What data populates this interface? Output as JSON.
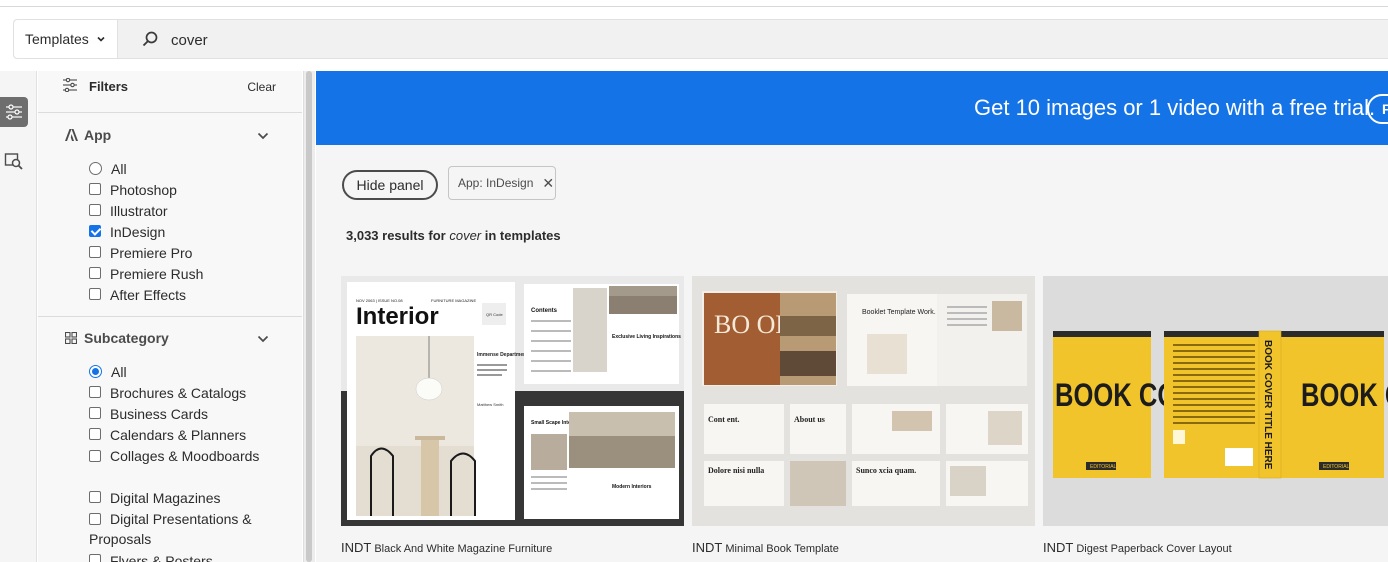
{
  "search": {
    "scope_label": "Templates",
    "query": "cover"
  },
  "filters": {
    "title": "Filters",
    "clear_label": "Clear"
  },
  "app_section": {
    "title": "App",
    "options": [
      {
        "label": "All",
        "type": "radio",
        "checked": false
      },
      {
        "label": "Photoshop",
        "type": "checkbox",
        "checked": false
      },
      {
        "label": "Illustrator",
        "type": "checkbox",
        "checked": false
      },
      {
        "label": "InDesign",
        "type": "checkbox",
        "checked": true
      },
      {
        "label": "Premiere Pro",
        "type": "checkbox",
        "checked": false
      },
      {
        "label": "Premiere Rush",
        "type": "checkbox",
        "checked": false
      },
      {
        "label": "After Effects",
        "type": "checkbox",
        "checked": false
      }
    ]
  },
  "subcategory_section": {
    "title": "Subcategory",
    "options": [
      {
        "label": "All",
        "type": "radio",
        "checked": true
      },
      {
        "label": "Brochures & Catalogs",
        "type": "checkbox",
        "checked": false
      },
      {
        "label": "Business Cards",
        "type": "checkbox",
        "checked": false
      },
      {
        "label": "Calendars & Planners",
        "type": "checkbox",
        "checked": false
      },
      {
        "label": "Collages & Moodboards",
        "type": "checkbox",
        "checked": false
      },
      {
        "label": "Digital Magazines",
        "type": "checkbox",
        "checked": false
      },
      {
        "label": "Digital Presentations & Proposals",
        "type": "checkbox",
        "checked": false
      },
      {
        "label": "Flyers & Posters",
        "type": "checkbox",
        "checked": false
      }
    ]
  },
  "banner": {
    "text": "Get 10 images or 1 video with a free trial.",
    "button_label": "F"
  },
  "toolbar": {
    "hide_panel_label": "Hide panel",
    "tag_label": "App: InDesign",
    "tag_close": "✕"
  },
  "results": {
    "count": "3,033 results for",
    "query": "cover",
    "scope": "in templates"
  },
  "cards": [
    {
      "app": "INDT",
      "name": "Black And White Magazine Furniture",
      "image": {
        "masthead": "Interior",
        "issue": "NOV 2063 | ISSUE NO.08",
        "category": "FURNITURE MAGAZINE",
        "code": "QR Code",
        "feature": "Immense Department",
        "byline": "Matthew Smith",
        "contents": "Contents",
        "spread_title_1": "Exclusive Living Inspirations",
        "spread_title_2": "Small Scape Interiors",
        "spread_title_3": "Modern Interiors"
      }
    },
    {
      "app": "INDT",
      "name": "Minimal Book Template",
      "image": {
        "cover_text": "BO OK",
        "booklet_title": "Booklet Template Work.",
        "thumb_1": "Cont ent.",
        "thumb_2": "About us",
        "thumb_3": "Dolore nisi nulla",
        "thumb_4": "Sunco xcia quam."
      }
    },
    {
      "app": "INDT",
      "name": "Digest Paperback Cover Layout",
      "image": {
        "cover_title": "BOOK COVER",
        "spine_title": "BOOK COVER TITLE HERE",
        "badge": "EDITORIAL"
      }
    }
  ],
  "colors": {
    "banner_blue": "#1473e6",
    "cover_yellow": "#f2c42c",
    "panel_bg": "#f8f8f8"
  }
}
